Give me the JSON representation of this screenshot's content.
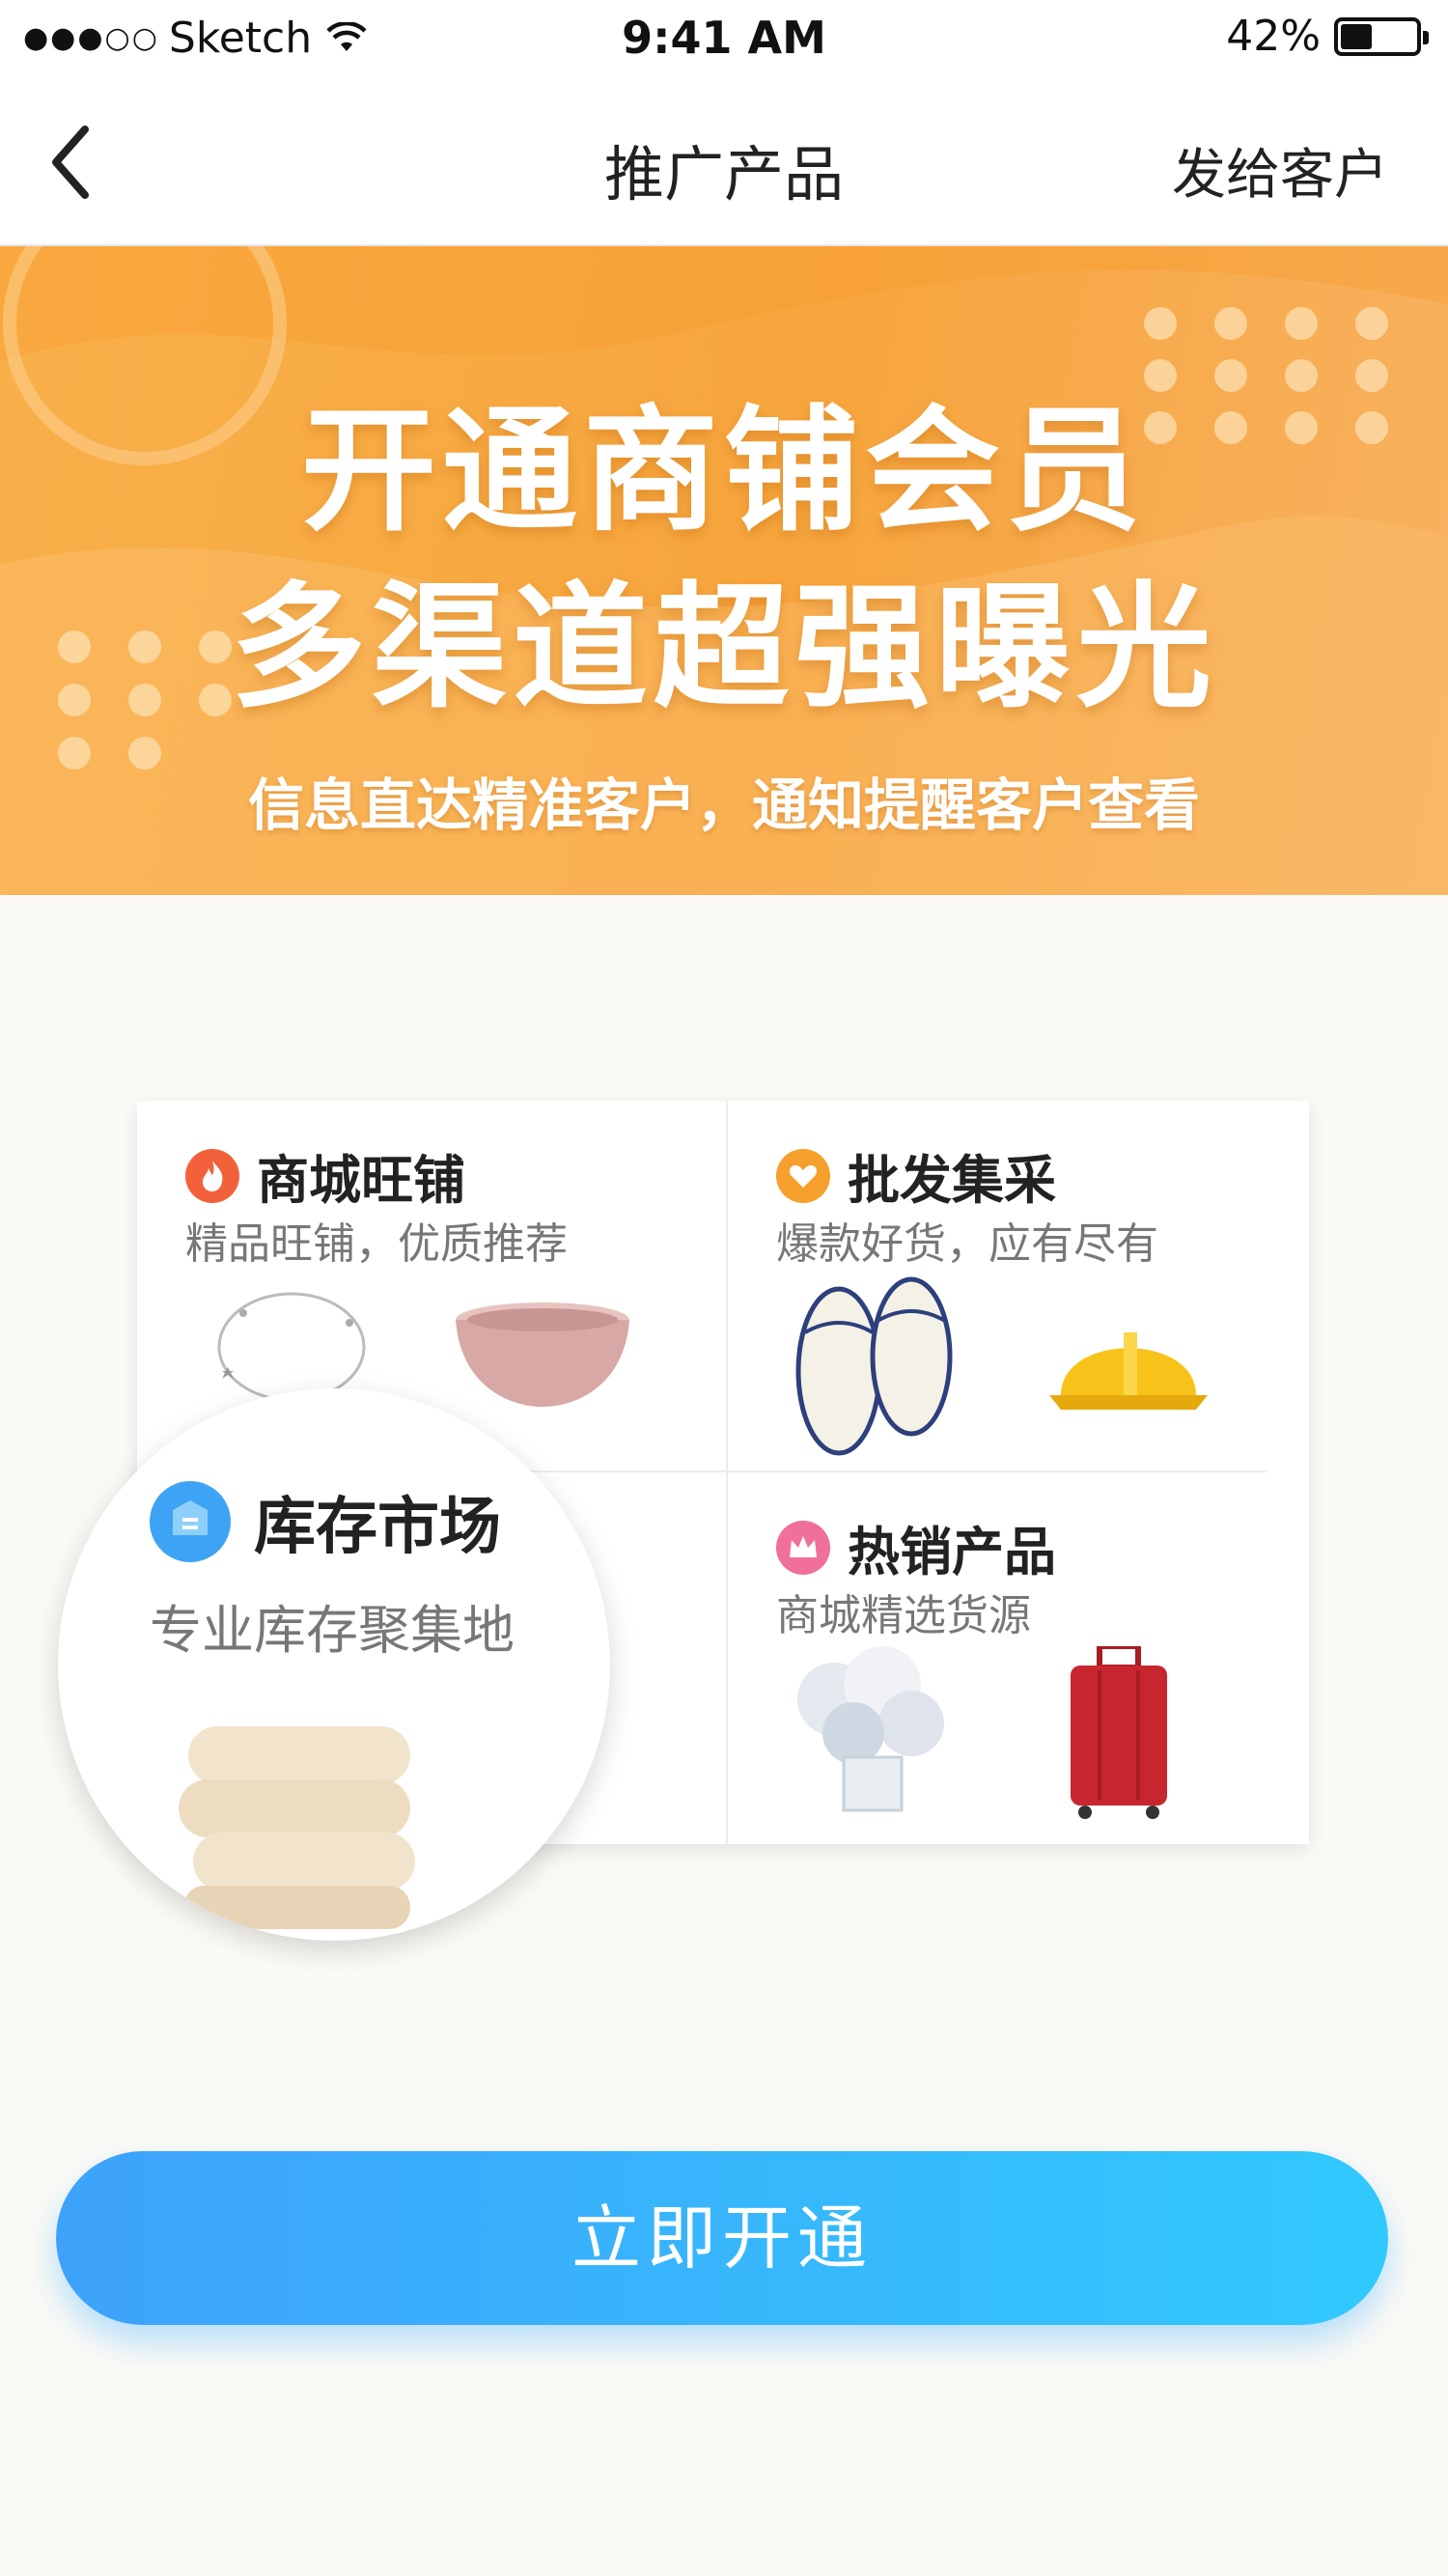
{
  "status_bar": {
    "carrier": "Sketch",
    "time": "9:41 AM",
    "battery_percent": "42%",
    "battery_level": 0.42
  },
  "nav": {
    "title": "推广产品",
    "action": "发给客户",
    "back_icon": "chevron-left-icon"
  },
  "banner": {
    "headline_1": "开通商铺会员",
    "headline_2": "多渠道超强曝光",
    "subline": "信息直达精准客户，通知提醒客户查看",
    "colors": {
      "from": "#f9b04a",
      "to": "#f8b261"
    }
  },
  "features": [
    {
      "title": "商城旺铺",
      "subtitle": "精品旺铺，优质推荐",
      "icon": "flame-icon",
      "color": "#f2613a",
      "products": [
        "bracelet-image",
        "pink-bowl-image"
      ]
    },
    {
      "title": "批发集采",
      "subtitle": "爆款好货，应有尽有",
      "icon": "heart-icon",
      "color": "#f5a02d",
      "products": [
        "slippers-image",
        "hard-hat-image"
      ]
    },
    {
      "title": "库存市场",
      "subtitle": "专业库存聚集地",
      "icon": "inventory-icon",
      "color": "#3da3f5",
      "products": [
        "quilt-image"
      ]
    },
    {
      "title": "热销产品",
      "subtitle": "商城精选货源",
      "icon": "crown-icon",
      "color": "#f0709a",
      "products": [
        "flowers-image",
        "suitcase-image"
      ]
    }
  ],
  "cta": {
    "label": "立即开通",
    "colors": {
      "from": "#3ea2fb",
      "to": "#31c9fd"
    }
  }
}
